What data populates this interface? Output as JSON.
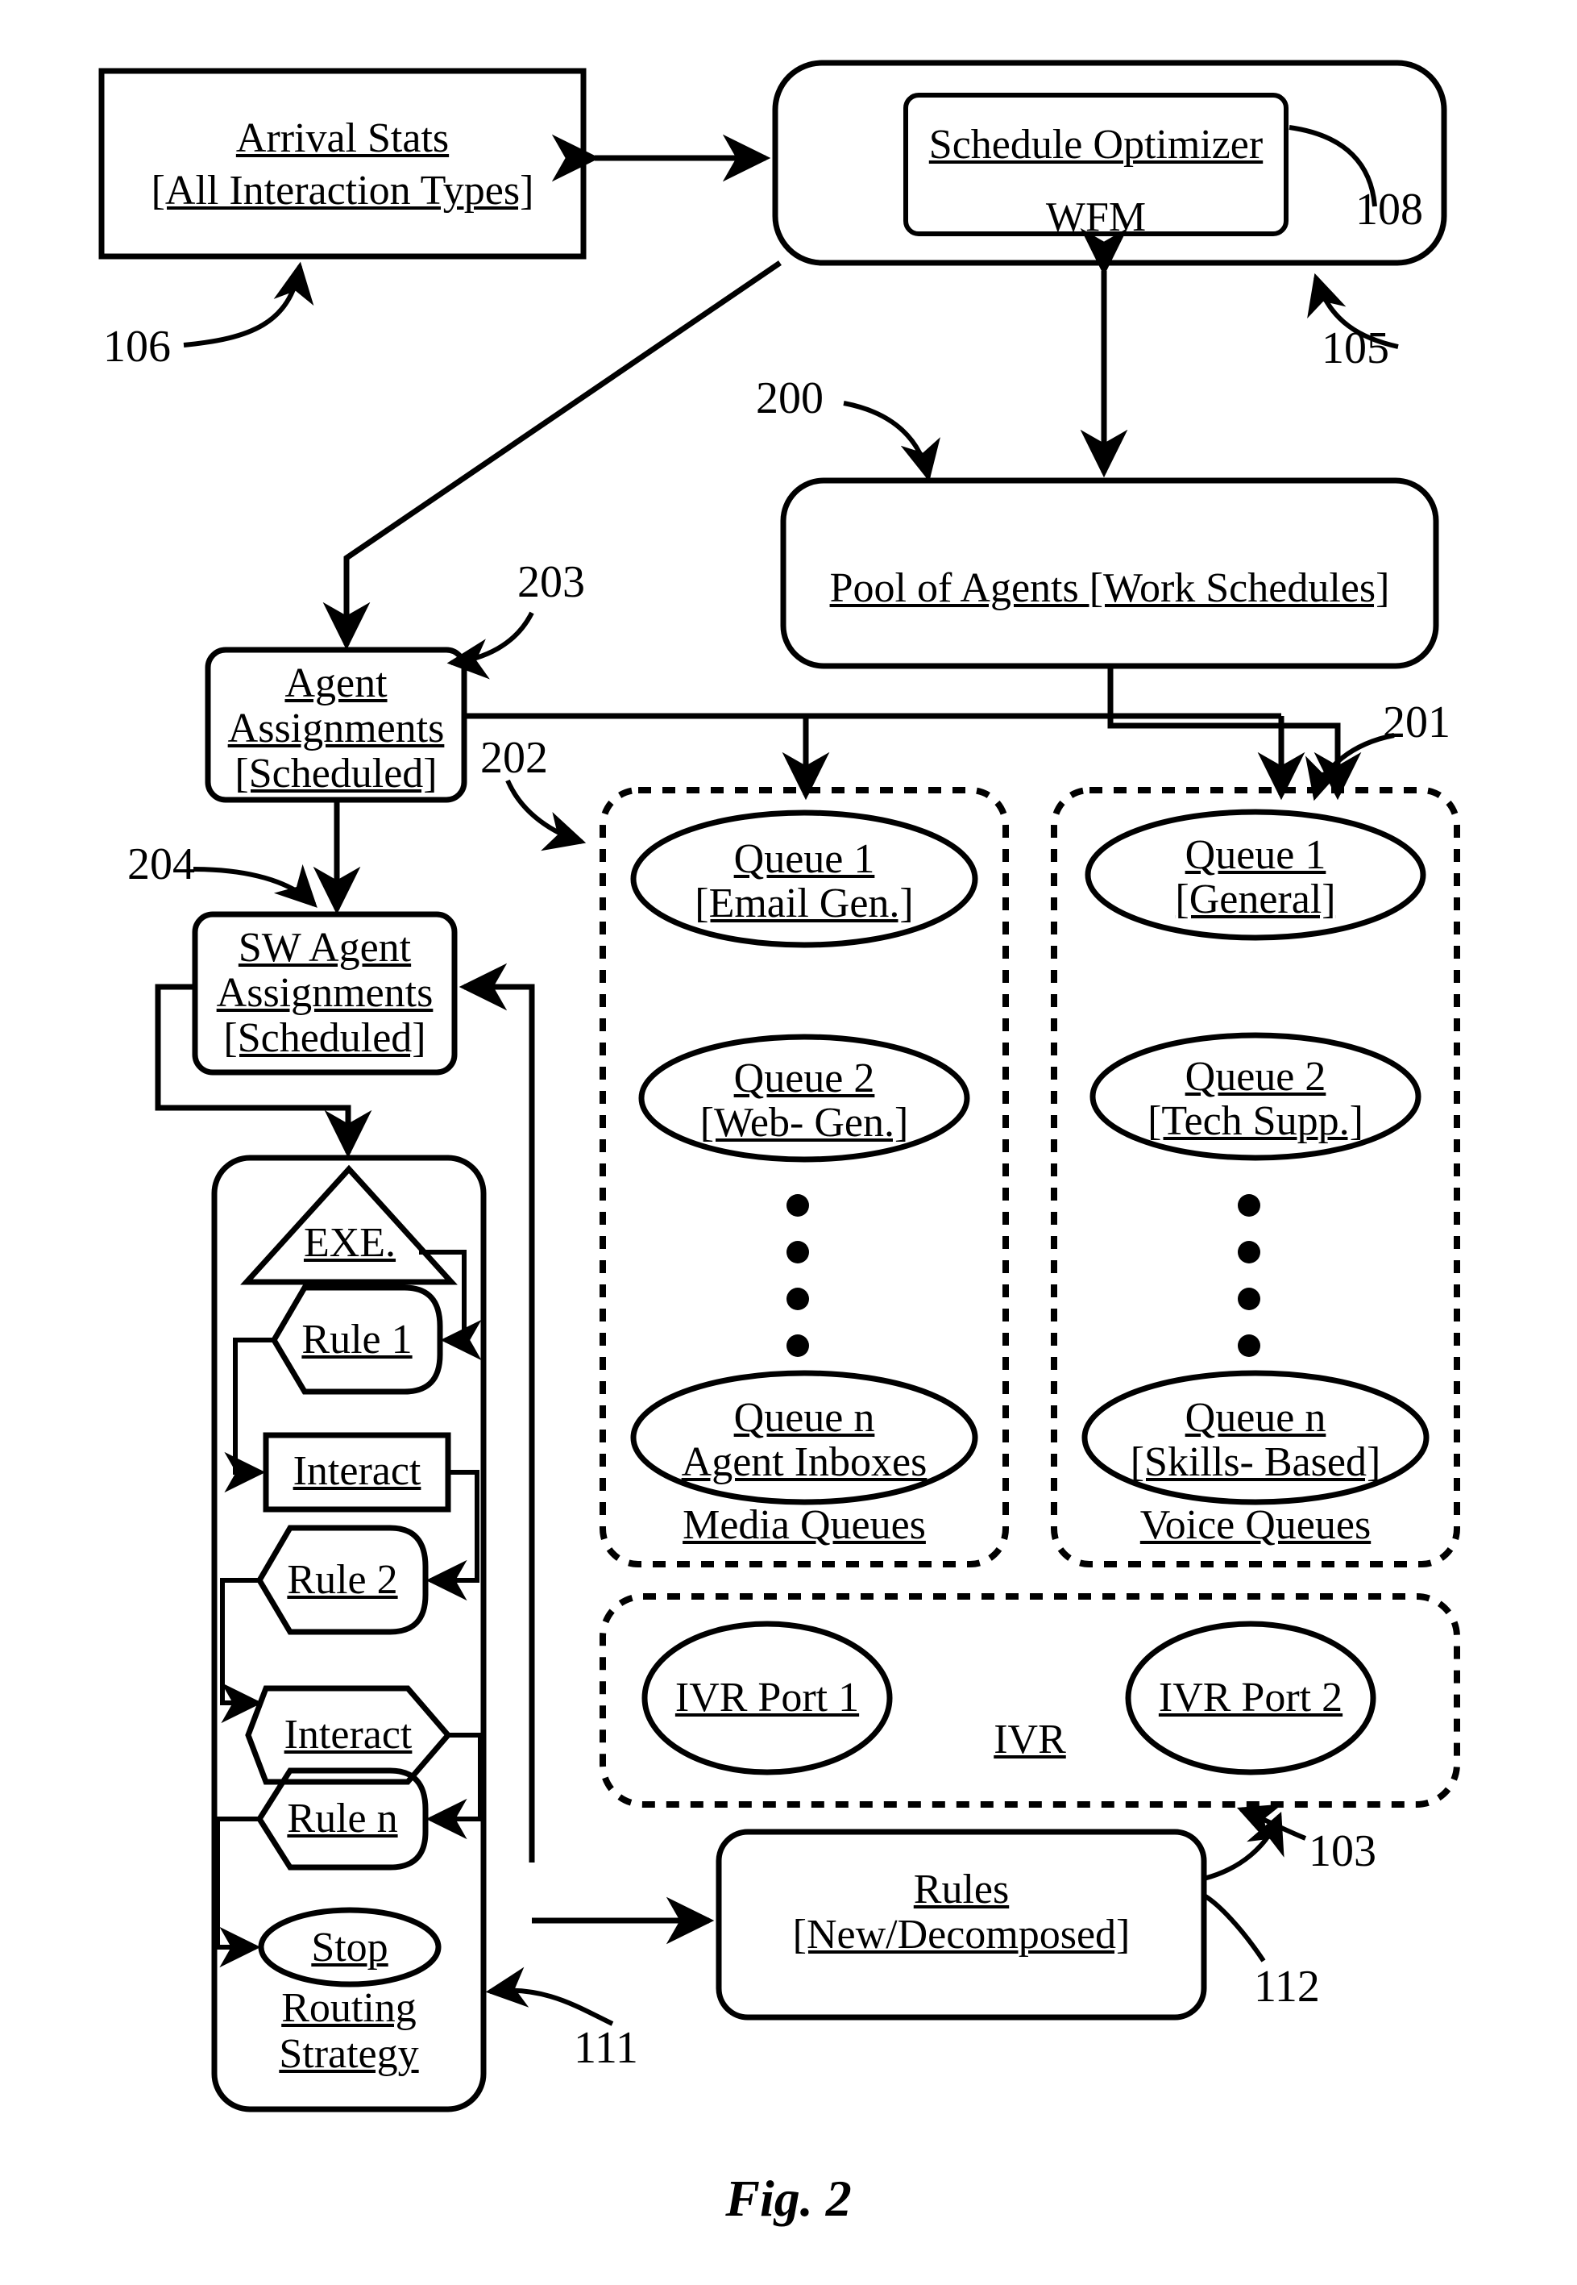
{
  "figure": {
    "caption": "Fig. 2"
  },
  "nodes": {
    "arrival_stats": {
      "line1": "Arrival Stats",
      "line2": "[All Interaction Types]"
    },
    "wfm": {
      "inner": "Schedule Optimizer",
      "label": "WFM"
    },
    "pool_of_agents": {
      "label": "Pool of Agents [Work Schedules]"
    },
    "agent_assignments": {
      "line1": "Agent",
      "line2": "Assignments",
      "line3": "[Scheduled]"
    },
    "sw_agent_assignments": {
      "line1": "SW Agent",
      "line2": "Assignments",
      "line3": "[Scheduled]"
    },
    "rules": {
      "line1": "Rules",
      "line2": "[New/Decomposed]"
    },
    "routing_strategy": {
      "group_label_line1": "Routing",
      "group_label_line2": "Strategy",
      "steps": [
        {
          "shape": "triangle",
          "label": "EXE."
        },
        {
          "shape": "rule",
          "label": "Rule 1"
        },
        {
          "shape": "rect",
          "label": "Interact"
        },
        {
          "shape": "rule",
          "label": "Rule 2"
        },
        {
          "shape": "hexagon",
          "label": "Interact"
        },
        {
          "shape": "rule",
          "label": "Rule n"
        },
        {
          "shape": "ellipse",
          "label": "Stop"
        }
      ]
    },
    "media_queues": {
      "group_label": "Media Queues",
      "items": [
        {
          "line1": "Queue 1",
          "line2": "[Email Gen.]"
        },
        {
          "line1": "Queue 2",
          "line2": "[Web- Gen.]"
        },
        {
          "line1": "Queue n",
          "line2": "Agent Inboxes"
        }
      ],
      "ellipsis": "⋮"
    },
    "voice_queues": {
      "group_label": "Voice Queues",
      "items": [
        {
          "line1": "Queue 1",
          "line2": "[General]"
        },
        {
          "line1": "Queue 2",
          "line2": "[Tech Supp.]"
        },
        {
          "line1": "Queue n",
          "line2": "[Skills- Based]"
        }
      ],
      "ellipsis": "⋮"
    },
    "ivr": {
      "group_label": "IVR",
      "ports": [
        "IVR Port 1",
        "IVR Port 2"
      ]
    }
  },
  "reference_numerals": {
    "n106": "106",
    "n108": "108",
    "n105": "105",
    "n200": "200",
    "n203": "203",
    "n202": "202",
    "n204": "204",
    "n201": "201",
    "n103": "103",
    "n112": "112",
    "n111": "111"
  }
}
